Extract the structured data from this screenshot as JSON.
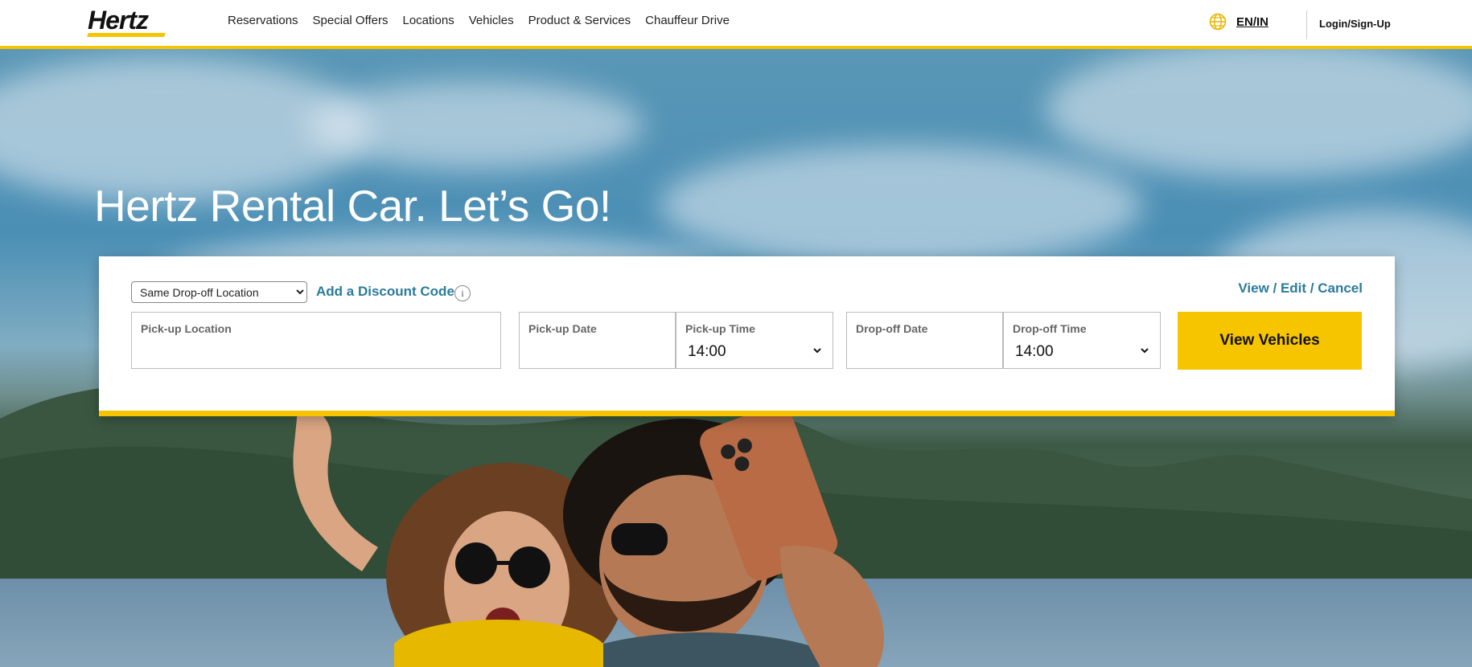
{
  "brand": {
    "logo_text": "Hertz",
    "accent_color": "#f7c400",
    "link_color": "#2b7b9c"
  },
  "nav": {
    "items": [
      {
        "label": "Reservations"
      },
      {
        "label": "Special Offers"
      },
      {
        "label": "Locations"
      },
      {
        "label": "Vehicles"
      },
      {
        "label": "Product & Services"
      },
      {
        "label": "Chauffeur Drive"
      }
    ],
    "language": "EN/IN",
    "language_icon": "globe-icon",
    "login": "Login/Sign-Up"
  },
  "hero": {
    "title": "Hertz Rental Car. Let’s Go!"
  },
  "booking": {
    "dropoff_option": "Same Drop-off Location",
    "discount_link": "Add a Discount Code",
    "info_icon_glyph": "i",
    "manage_link": "View / Edit / Cancel",
    "pickup_location_label": "Pick-up Location",
    "pickup_date_label": "Pick-up Date",
    "pickup_time_label": "Pick-up Time",
    "pickup_time_value": "14:00",
    "dropoff_date_label": "Drop-off Date",
    "dropoff_time_label": "Drop-off Time",
    "dropoff_time_value": "14:00",
    "submit_label": "View Vehicles"
  }
}
